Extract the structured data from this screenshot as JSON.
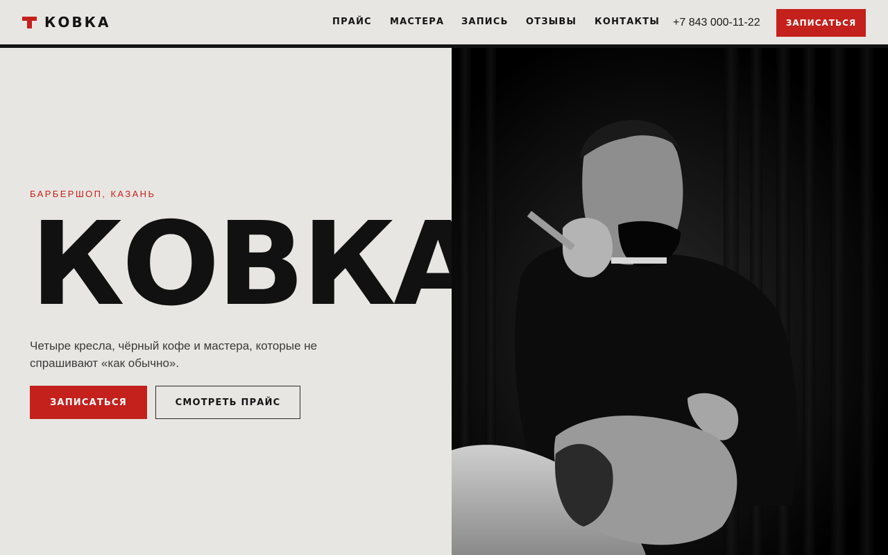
{
  "brand": {
    "name": "КОВКА",
    "accent": "#c4201c"
  },
  "nav": {
    "items": [
      {
        "label": "ПРАЙС"
      },
      {
        "label": "МАСТЕРА"
      },
      {
        "label": "ЗАПИСЬ"
      },
      {
        "label": "ОТЗЫВЫ"
      },
      {
        "label": "КОНТАКТЫ"
      }
    ],
    "phone": "+7 843 000-11-22",
    "cta_label": "ЗАПИСАТЬСЯ"
  },
  "hero": {
    "eyebrow": "БАРБЕРШОП, КАЗАНЬ",
    "title": "КОВКА",
    "lede": "Четыре кресла, чёрный кофе и мастера, которые не спрашивают «как обычно».",
    "primary_button": "ЗАПИСАТЬСЯ",
    "secondary_button": "СМОТРЕТЬ ПРАЙС"
  },
  "colors": {
    "background": "#e8e6e2",
    "text": "#141414",
    "accent": "#c4201c",
    "photo_bg": "#0a0a0a"
  }
}
